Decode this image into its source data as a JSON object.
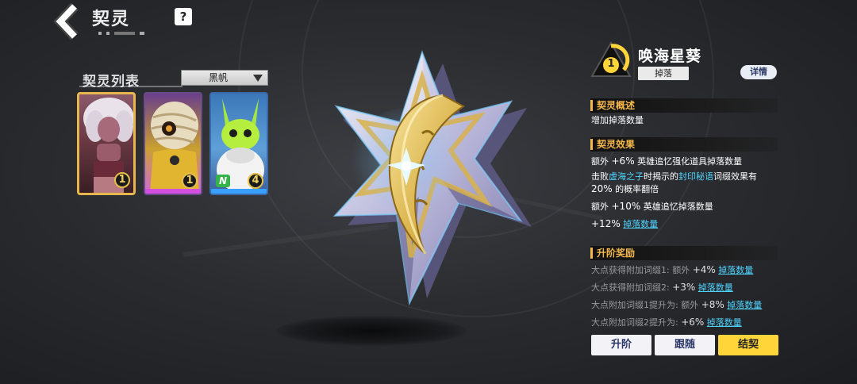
{
  "header": {
    "title": "契灵",
    "help_label": "?"
  },
  "list": {
    "title": "契灵列表",
    "filter_selected": "黑帆",
    "cards": [
      {
        "level": "1",
        "selected": true
      },
      {
        "level": "1",
        "selected": false
      },
      {
        "level": "4",
        "badge": "N",
        "selected": false
      }
    ]
  },
  "spirit": {
    "rank": "1",
    "name": "唤海星葵",
    "type_tag": "掉落",
    "detail_label": "详情"
  },
  "overview": {
    "title": "契灵概述",
    "text": "增加掉落数量"
  },
  "effects": {
    "title": "契灵效果",
    "line1_prefix": "额外 ",
    "line1_value": "+6%",
    "line1_suffix": " 英雄追忆强化道具掉落数量",
    "line2_a": "击败",
    "line2_link1": "虚海之子",
    "line2_b": "时揭示的",
    "line2_link2": "封印秘语",
    "line2_c": "词缀效果有",
    "line3_value": "20%",
    "line3_suffix": " 的概率翻倍",
    "line4_prefix": "额外 ",
    "line4_value": "+10%",
    "line4_suffix": " 英雄追忆掉落数量",
    "line5_value": "+12%",
    "line5_link": "掉落数量"
  },
  "ascension": {
    "title": "升阶奖励",
    "rows": [
      {
        "label": "大点获得附加词缀1: 额外 ",
        "value": "+4%",
        "link": "掉落数量"
      },
      {
        "label": "大点获得附加词缀2: ",
        "value": "+3%",
        "link": "掉落数量"
      },
      {
        "label": "大点附加词缀1提升为: 额外 ",
        "value": "+8%",
        "link": "掉落数量"
      },
      {
        "label": "大点附加词缀2提升为: ",
        "value": "+6%",
        "link": "掉落数量"
      }
    ]
  },
  "actions": {
    "ascend": "升阶",
    "follow": "跟随",
    "bond": "结契"
  },
  "colors": {
    "accent": "#f3b74a",
    "link": "#4fd4ff",
    "primary_button": "#ffd53a"
  }
}
